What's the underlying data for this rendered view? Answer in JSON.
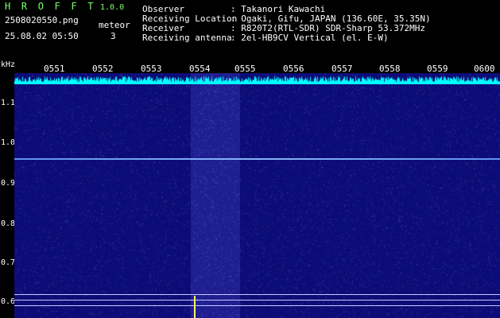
{
  "header": {
    "title": "H R O F F T",
    "version": "1.0.0",
    "filename": "2508020550.png",
    "meteor_label": "meteor",
    "datetime": "25.08.02 05:50",
    "meteor_count": "3"
  },
  "info": [
    {
      "label": "Observer",
      "value": ": Takanori Kawachi"
    },
    {
      "label": "Receiving Location",
      "value": ": Ogaki, Gifu, JAPAN (136.60E, 35.35N)"
    },
    {
      "label": "Receiver",
      "value": ": R820T2(RTL-SDR) SDR-Sharp 53.372MHz"
    },
    {
      "label": "Receiving antenna",
      "value": ": 2el-HB9CV Vertical (el. E-W)"
    }
  ],
  "spectrogram": {
    "unit_label": "kHz",
    "time_ticks": [
      "0551",
      "0552",
      "0553",
      "0554",
      "0555",
      "0556",
      "0557",
      "0558",
      "0559",
      "0600"
    ],
    "freq_ticks": [
      "1.1",
      "1.0",
      "0.9",
      "0.8",
      "0.7",
      "0.6"
    ],
    "colors": {
      "background": "#0c0c78",
      "trace": "#8cbeff",
      "spike": "#ffff66",
      "noise": "#00ffff"
    }
  }
}
